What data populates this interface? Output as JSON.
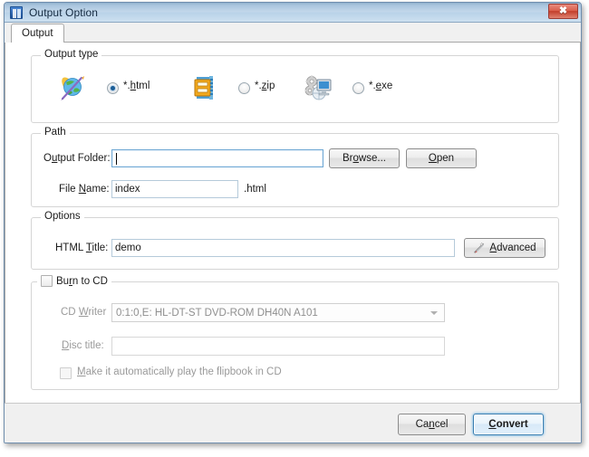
{
  "window": {
    "title": "Output Option",
    "icon": "app-book-icon",
    "close_label": "✖"
  },
  "tabs": [
    {
      "label": "Output",
      "active": true
    }
  ],
  "output_type": {
    "legend": "Output type",
    "options": [
      {
        "icon": "globe-pencil-icon",
        "label_pre": "*.",
        "label_key": "h",
        "label_post": "tml",
        "checked": true
      },
      {
        "icon": "zip-archive-icon",
        "label_pre": "*.",
        "label_key": "z",
        "label_post": "ip",
        "checked": false
      },
      {
        "icon": "gears-monitor-icon",
        "label_pre": "*.",
        "label_key": "e",
        "label_post": "xe",
        "checked": false
      }
    ]
  },
  "path": {
    "legend": "Path",
    "output_folder_label_pre": "O",
    "output_folder_label_key": "u",
    "output_folder_label_post": "tput Folder:",
    "output_folder_value": "",
    "browse_label_pre": "Br",
    "browse_label_key": "o",
    "browse_label_post": "wse...",
    "open_label_key": "O",
    "open_label_post": "pen",
    "file_name_label_pre": "File ",
    "file_name_label_key": "N",
    "file_name_label_post": "ame:",
    "file_name_value": "index",
    "extension": ".html"
  },
  "options": {
    "legend": "Options",
    "html_title_label_pre": "HTML ",
    "html_title_label_key": "T",
    "html_title_label_post": "itle:",
    "html_title_value": "demo",
    "advanced_label_key": "A",
    "advanced_label_post": "dvanced",
    "advanced_icon": "magic-wand-icon"
  },
  "burn_to_cd": {
    "legend_pre": "Bu",
    "legend_key": "r",
    "legend_post": "n to CD",
    "checked": false,
    "cd_writer_label_pre": "CD ",
    "cd_writer_label_key": "W",
    "cd_writer_label_post": "riter",
    "cd_writer_value": "0:1:0,E: HL-DT-ST DVD-ROM DH40N   A101",
    "disc_title_label_key": "D",
    "disc_title_label_post": "isc title:",
    "disc_title_value": "",
    "autoplay_label_key": "M",
    "autoplay_label_post": "ake it automatically play the flipbook in CD",
    "autoplay_checked": false
  },
  "footer": {
    "cancel_label_pre": "Ca",
    "cancel_label_key": "n",
    "cancel_label_post": "cel",
    "convert_label_key": "C",
    "convert_label_post": "onvert"
  },
  "colors": {
    "titlebar_top": "#8fb0cd",
    "titlebar_bottom": "#cde0f0",
    "close_red": "#c23e2b",
    "focus_blue": "#3c7fb1",
    "radio_dot": "#1b5d96"
  }
}
